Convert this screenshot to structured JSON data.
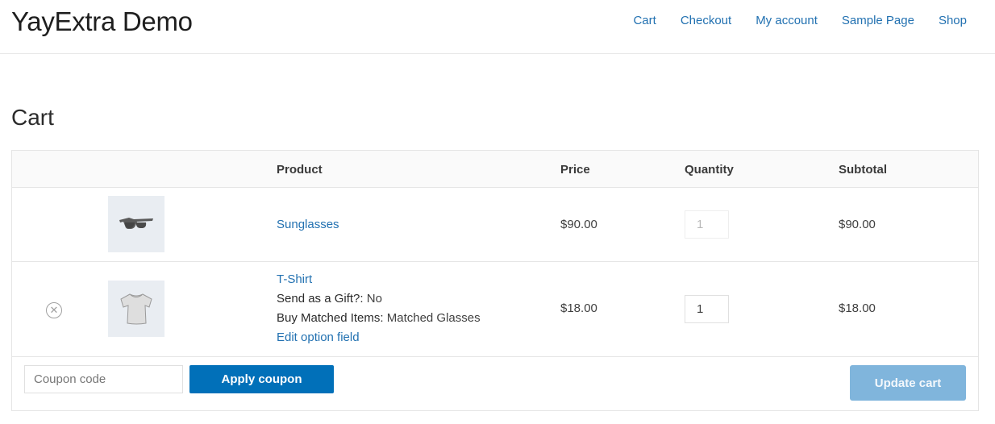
{
  "site": {
    "title": "YayExtra Demo",
    "nav": [
      "Cart",
      "Checkout",
      "My account",
      "Sample Page",
      "Shop"
    ]
  },
  "page": {
    "title": "Cart"
  },
  "table": {
    "headers": {
      "product": "Product",
      "price": "Price",
      "quantity": "Quantity",
      "subtotal": "Subtotal"
    },
    "items": [
      {
        "name": "Sunglasses",
        "image_icon": "sunglasses-icon",
        "price": "$90.00",
        "quantity": "1",
        "quantity_disabled": true,
        "subtotal": "$90.00",
        "removable": false
      },
      {
        "name": "T-Shirt",
        "image_icon": "tshirt-icon",
        "price": "$18.00",
        "quantity": "1",
        "quantity_disabled": false,
        "subtotal": "$18.00",
        "removable": true,
        "remove_icon": "close-circle-icon",
        "meta": [
          {
            "label": "Send as a Gift?:",
            "value": "No"
          },
          {
            "label": "Buy Matched Items:",
            "value": "Matched Glasses"
          }
        ],
        "edit_link": "Edit option field"
      }
    ]
  },
  "actions": {
    "coupon_placeholder": "Coupon code",
    "apply_label": "Apply coupon",
    "update_label": "Update cart"
  },
  "colors": {
    "link": "#2271b1",
    "primary_button": "#0170b9",
    "disabled_button": "#80b5dc",
    "thumb_bg": "#e9edf2"
  }
}
